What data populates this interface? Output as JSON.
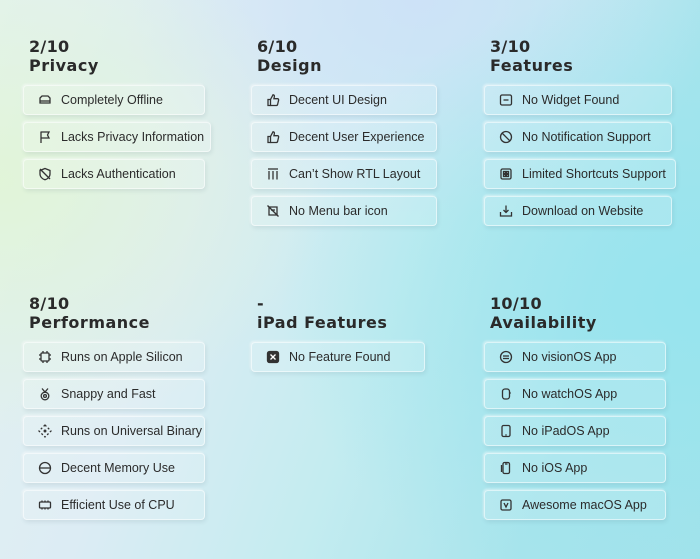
{
  "privacy": {
    "score": "2/10",
    "title": "Privacy",
    "items": [
      {
        "label": "Completely Offline",
        "icon": "drive-icon"
      },
      {
        "label": "Lacks Privacy Information",
        "icon": "flag-icon"
      },
      {
        "label": "Lacks Authentication",
        "icon": "shield-slash-icon"
      }
    ]
  },
  "design": {
    "score": "6/10",
    "title": "Design",
    "items": [
      {
        "label": "Decent UI Design",
        "icon": "thumbs-up-icon"
      },
      {
        "label": "Decent User Experience",
        "icon": "thumbs-up-icon"
      },
      {
        "label": "Can’t Show RTL Layout",
        "icon": "text-direction-icon"
      },
      {
        "label": "No Menu bar icon",
        "icon": "menubar-slash-icon"
      }
    ]
  },
  "features": {
    "score": "3/10",
    "title": "Features",
    "items": [
      {
        "label": "No Widget Found",
        "icon": "widget-icon"
      },
      {
        "label": "No Notification Support",
        "icon": "notification-slash-icon"
      },
      {
        "label": "Limited Shortcuts Support",
        "icon": "shortcuts-icon"
      },
      {
        "label": "Download on Website",
        "icon": "download-icon"
      }
    ]
  },
  "performance": {
    "score": "8/10",
    "title": "Performance",
    "items": [
      {
        "label": "Runs on Apple Silicon",
        "icon": "chip-icon"
      },
      {
        "label": "Snappy and Fast",
        "icon": "medal-icon"
      },
      {
        "label": "Runs on Universal Binary",
        "icon": "diamond-arrows-icon"
      },
      {
        "label": "Decent Memory Use",
        "icon": "memory-icon"
      },
      {
        "label": "Efficient Use of CPU",
        "icon": "cpu-icon"
      }
    ]
  },
  "ipad": {
    "score": "-",
    "title": "iPad Features",
    "items": [
      {
        "label": "No Feature Found",
        "icon": "x-square-icon"
      }
    ]
  },
  "availability": {
    "score": "10/10",
    "title": "Availability",
    "items": [
      {
        "label": "No visionOS App",
        "icon": "vision-icon"
      },
      {
        "label": "No watchOS App",
        "icon": "watch-icon"
      },
      {
        "label": "No iPadOS App",
        "icon": "ipad-icon"
      },
      {
        "label": "No iOS App",
        "icon": "iphone-icon"
      },
      {
        "label": "Awesome macOS App",
        "icon": "mac-app-icon"
      }
    ]
  }
}
